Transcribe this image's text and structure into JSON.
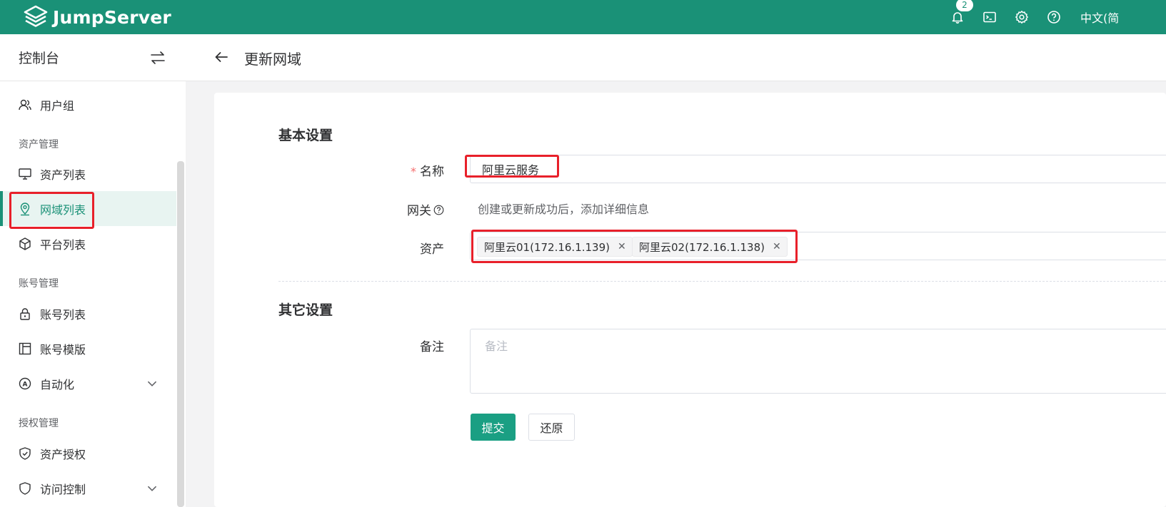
{
  "app": {
    "brand": "JumpServer",
    "notification_count": "2",
    "language": "中文(简"
  },
  "header_icons": [
    "bell-icon",
    "terminal-icon",
    "settings-icon",
    "help-icon"
  ],
  "sidebar": {
    "title": "控制台",
    "items": [
      {
        "type": "item",
        "label": "用户组",
        "icon": "user-group-icon"
      },
      {
        "type": "group",
        "label": "资产管理"
      },
      {
        "type": "item",
        "label": "资产列表",
        "icon": "monitor-icon"
      },
      {
        "type": "item",
        "label": "网域列表",
        "icon": "location-pin-icon",
        "active": true
      },
      {
        "type": "item",
        "label": "平台列表",
        "icon": "cube-icon"
      },
      {
        "type": "group",
        "label": "账号管理"
      },
      {
        "type": "item",
        "label": "账号列表",
        "icon": "lock-icon"
      },
      {
        "type": "item",
        "label": "账号模版",
        "icon": "template-icon"
      },
      {
        "type": "item",
        "label": "自动化",
        "icon": "automation-icon",
        "expandable": true
      },
      {
        "type": "group",
        "label": "授权管理"
      },
      {
        "type": "item",
        "label": "资产授权",
        "icon": "shield-check-icon"
      },
      {
        "type": "item",
        "label": "访问控制",
        "icon": "access-control-icon",
        "expandable": true
      }
    ]
  },
  "page": {
    "title": "更新网域"
  },
  "form": {
    "section_basic": "基本设置",
    "name_label": "名称",
    "name_value": "阿里云服务",
    "gateway_label": "网关",
    "gateway_help": "创建或更新成功后，添加详细信息",
    "assets_label": "资产",
    "assets": [
      "阿里云01(172.16.1.139)",
      "阿里云02(172.16.1.138)"
    ],
    "section_other": "其它设置",
    "comment_label": "备注",
    "comment_placeholder": "备注",
    "submit_label": "提交",
    "reset_label": "还原"
  },
  "colors": {
    "brand": "#1a9177",
    "primary_button": "#1a9f83",
    "annotation": "#e8202a"
  }
}
